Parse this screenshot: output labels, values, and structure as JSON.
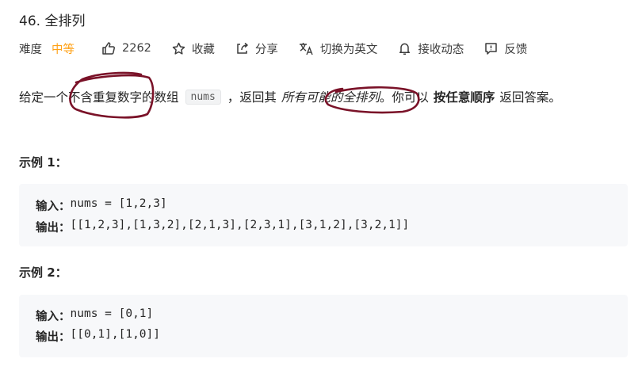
{
  "problem": {
    "title": "46. 全排列"
  },
  "meta": {
    "difficulty_label": "难度",
    "difficulty_value": "中等",
    "likes": "2262",
    "favorite_label": "收藏",
    "share_label": "分享",
    "translate_label": "切换为英文",
    "notify_label": "接收动态",
    "feedback_label": "反馈"
  },
  "description": {
    "part1": "给定一个不含重复数字的数组",
    "code": "nums",
    "part2": "，返回其",
    "em": "所有可能的全排列",
    "part3": "。你可以",
    "strong": "按任意顺序",
    "part4": "返回答案。"
  },
  "examples": [
    {
      "title": "示例 1：",
      "input_label": "输入：",
      "input_value": "nums = [1,2,3]",
      "output_label": "输出：",
      "output_value": "[[1,2,3],[1,3,2],[2,1,3],[2,3,1],[3,1,2],[3,2,1]]"
    },
    {
      "title": "示例 2：",
      "input_label": "输入：",
      "input_value": "nums = [0,1]",
      "output_label": "输出：",
      "output_value": "[[0,1],[1,0]]"
    }
  ],
  "colors": {
    "difficulty_medium": "#ffa116",
    "annotation_ink": "#7a1228",
    "code_block_bg": "#f7f8fa"
  },
  "icons": [
    "thumbs-up-icon",
    "star-icon",
    "share-icon",
    "translate-icon",
    "bell-icon",
    "feedback-icon"
  ]
}
